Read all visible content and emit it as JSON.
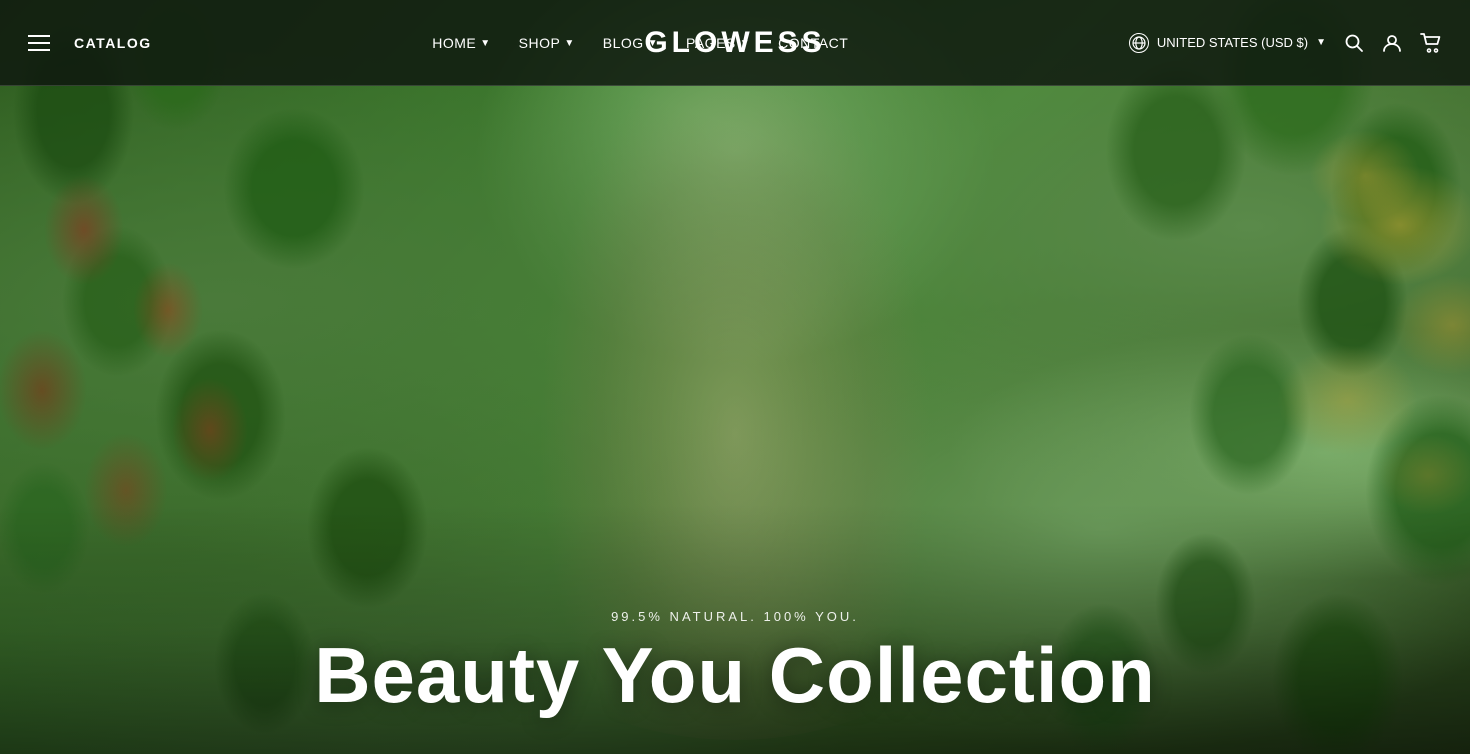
{
  "header": {
    "catalog_label": "CATALOG",
    "logo": "GLOWESS",
    "nav": [
      {
        "label": "HOME",
        "has_dropdown": true
      },
      {
        "label": "SHOP",
        "has_dropdown": true
      },
      {
        "label": "BLOG",
        "has_dropdown": true
      },
      {
        "label": "PAGES",
        "has_dropdown": true
      },
      {
        "label": "CONTACT",
        "has_dropdown": false
      }
    ],
    "currency": {
      "label": "UNITED STATES (USD $)",
      "has_dropdown": true
    },
    "icons": {
      "search": "🔍",
      "account": "👤",
      "cart": "🛒"
    }
  },
  "hero": {
    "tagline": "99.5% NATURAL. 100% YOU.",
    "title": "Beauty You Collection"
  }
}
